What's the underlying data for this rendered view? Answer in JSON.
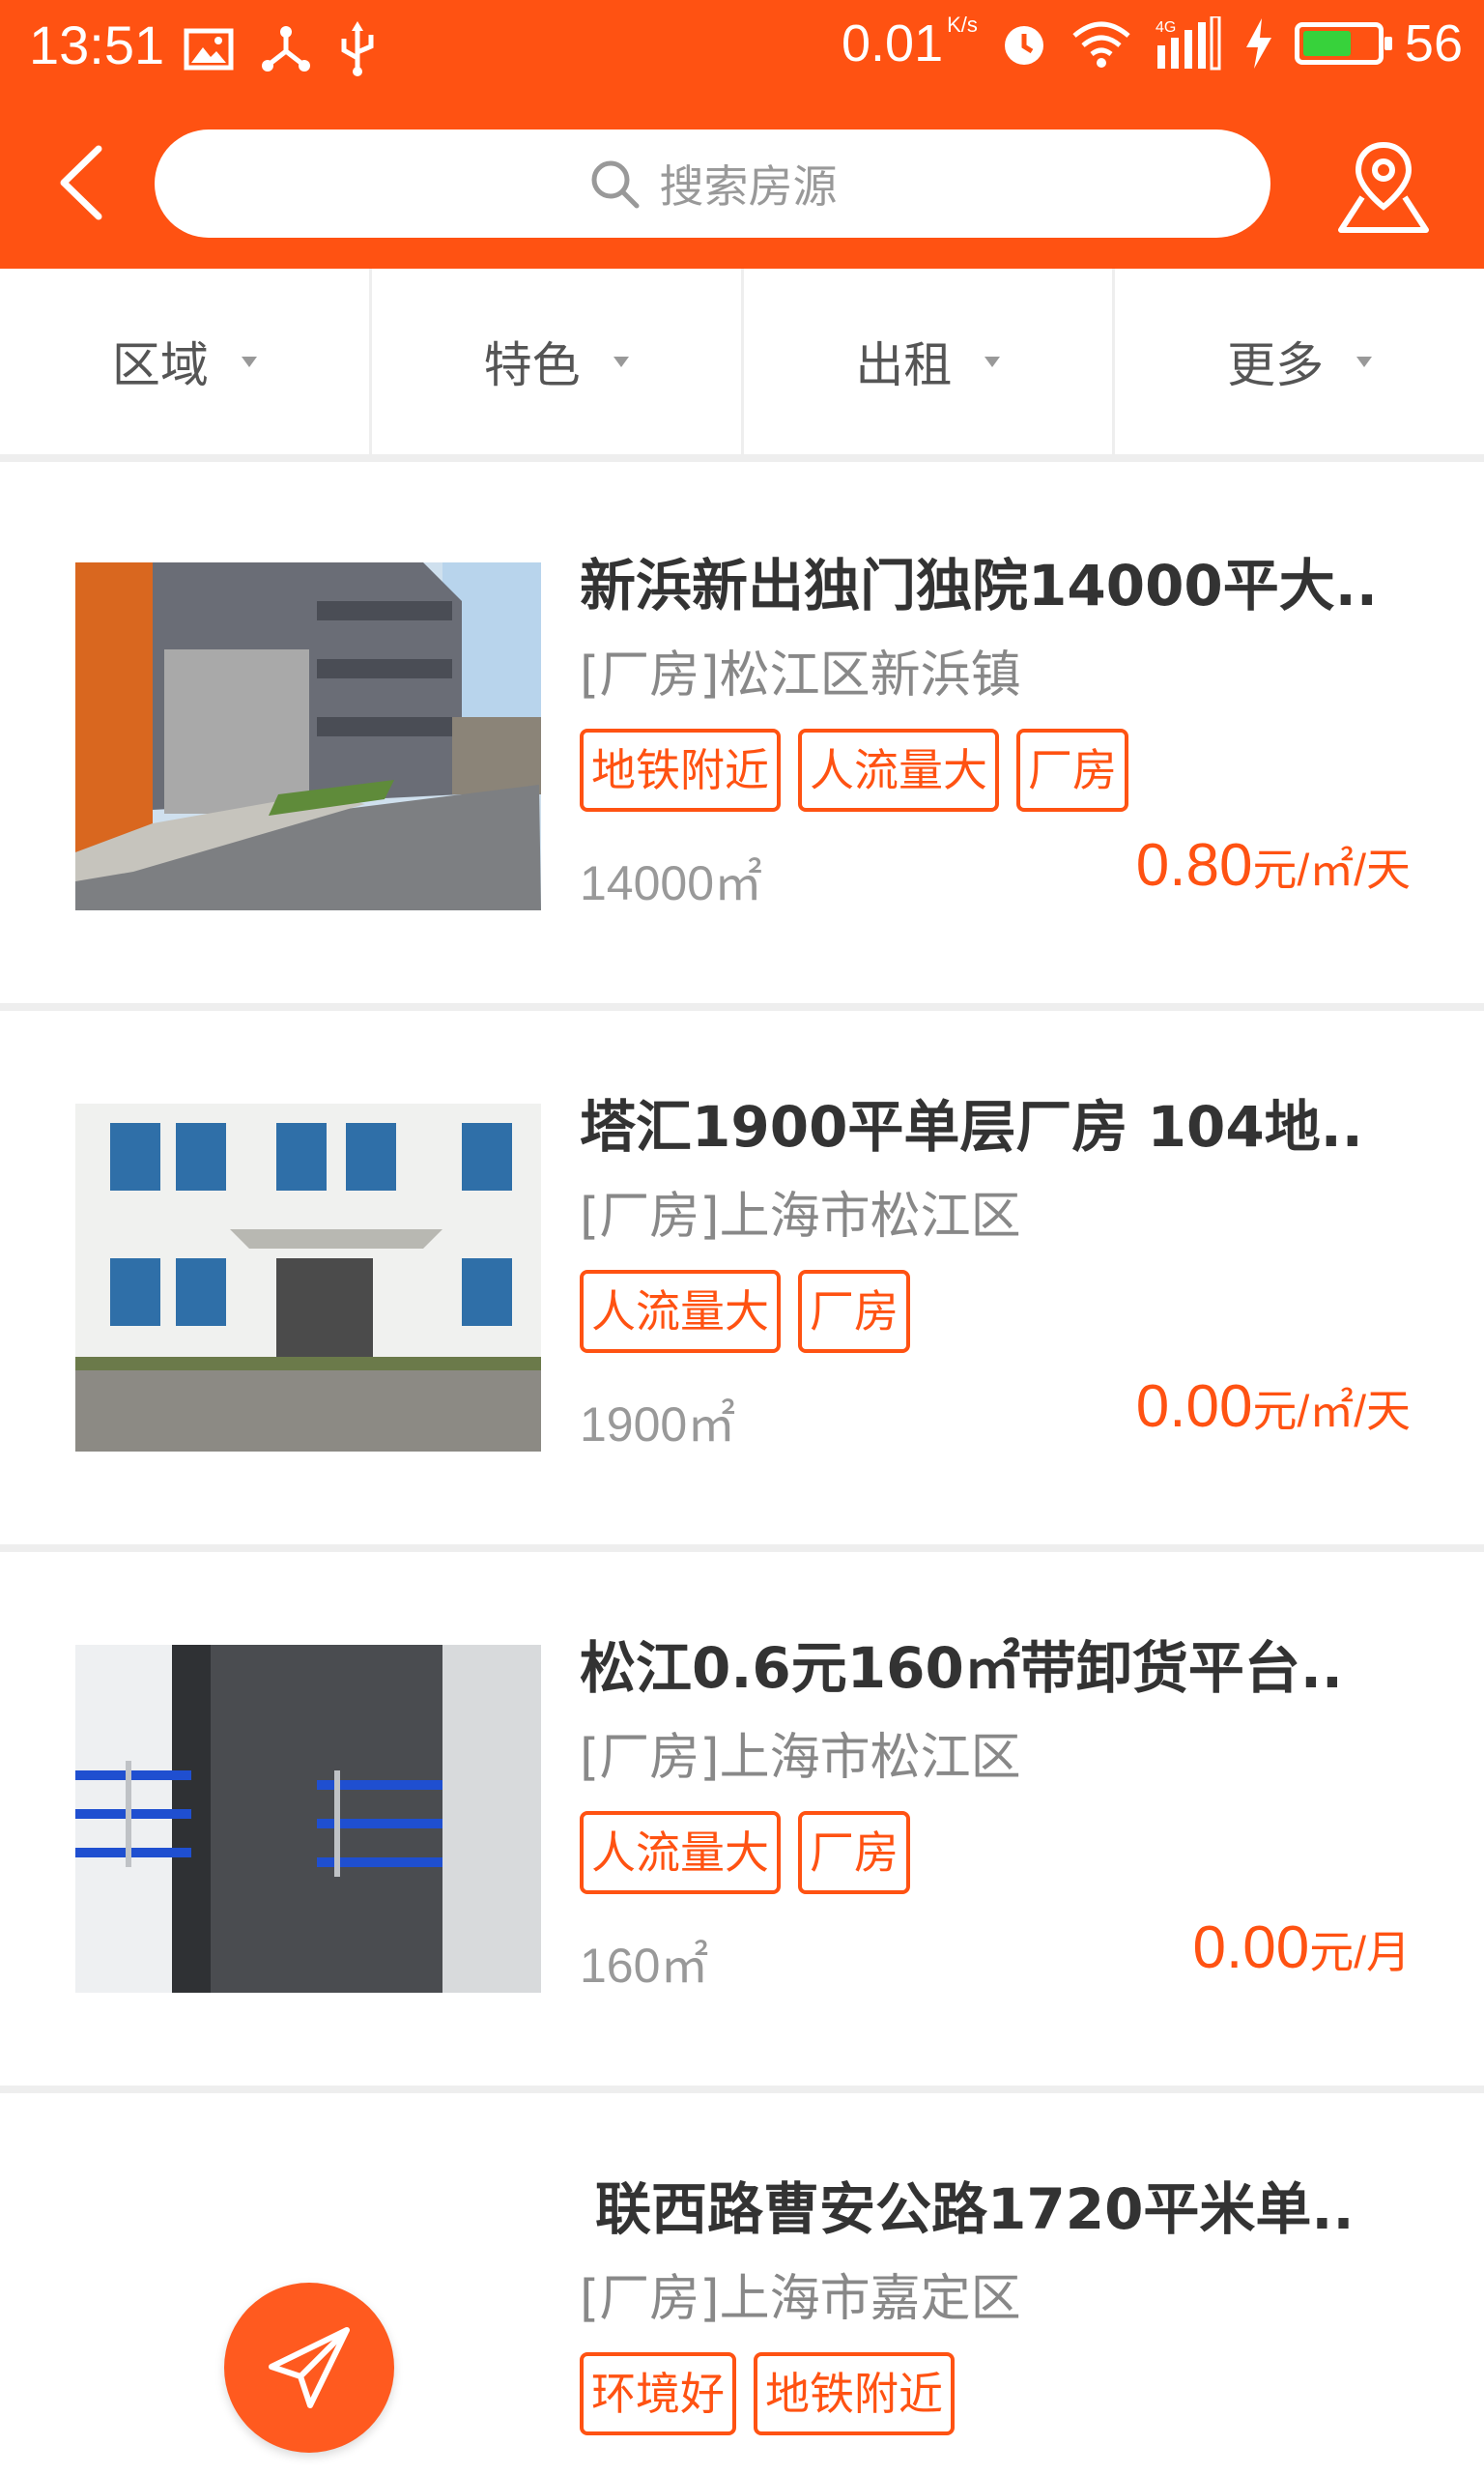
{
  "status_bar": {
    "time": "13:51",
    "net_speed": "0.01",
    "net_unit": "K/s",
    "battery": "56",
    "icons": [
      "image-icon",
      "share-icon",
      "usb-icon",
      "alarm-icon",
      "wifi-icon",
      "signal-4g-icon",
      "charging-icon",
      "battery-icon"
    ]
  },
  "header": {
    "search_placeholder": "搜索房源",
    "back_icon": "chevron-left-icon",
    "map_icon": "map-pin-icon"
  },
  "filters": [
    "区域",
    "特色",
    "出租",
    "更多"
  ],
  "colors": {
    "brand": "#ff5212",
    "tag_border": "#ff5212",
    "price": "#ff5212"
  },
  "listings": [
    {
      "title": "新浜新出独门独院14000平大..",
      "address": "[厂房]松江区新浜镇",
      "tags": [
        "地铁附近",
        "人流量大",
        "厂房"
      ],
      "area": "14000㎡",
      "price": "0.80",
      "price_unit": "元/㎡/天"
    },
    {
      "title": "塔汇1900平单层厂房 104地..",
      "address": "[厂房]上海市松江区",
      "tags": [
        "人流量大",
        "厂房"
      ],
      "area": "1900㎡",
      "price": "0.00",
      "price_unit": "元/㎡/天"
    },
    {
      "title": "松江0.6元160㎡带卸货平台..",
      "address": "[厂房]上海市松江区",
      "tags": [
        "人流量大",
        "厂房"
      ],
      "area": "160㎡",
      "price": "0.00",
      "price_unit": "元/月"
    },
    {
      "title": "联西路曹安公路1720平米单..",
      "address": "[厂房]上海市嘉定区",
      "tags": [
        "环境好",
        "地铁附近"
      ]
    }
  ]
}
